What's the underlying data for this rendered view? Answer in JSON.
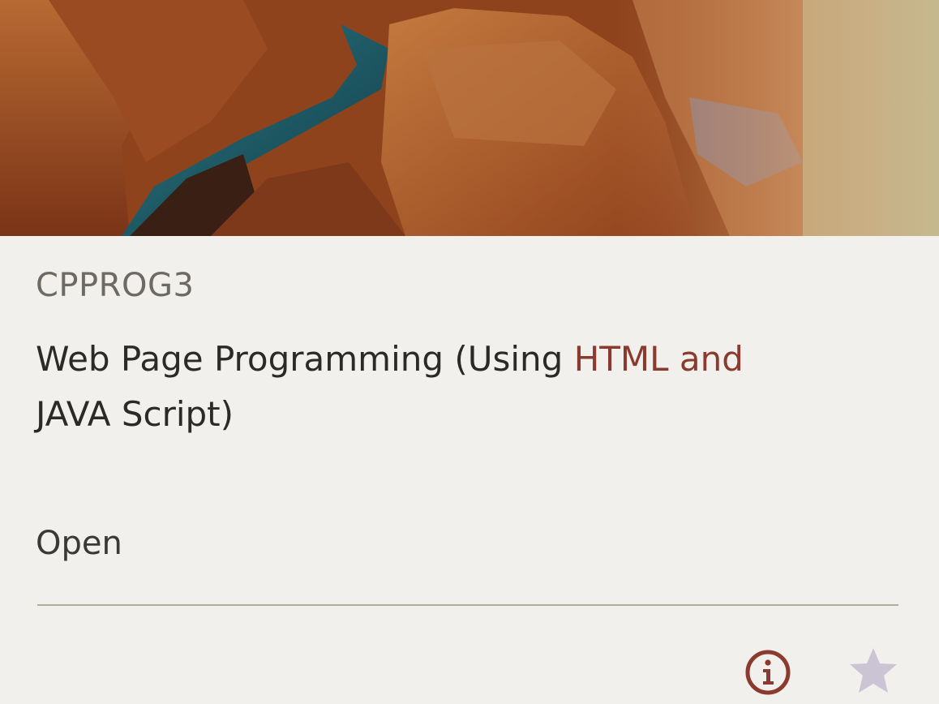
{
  "course": {
    "code": "CPPROG3",
    "title_part1": "Web Page Programming (Using ",
    "title_highlight": "HTML and",
    "title_part2": "JAVA Script)",
    "status": "Open"
  },
  "actions": {
    "info_icon": "info-icon",
    "favorite_icon": "star-icon"
  },
  "colors": {
    "accent": "#8a3a2e",
    "text_primary": "#2c2a27",
    "text_secondary": "#6d6a63",
    "divider": "#a8b39c"
  }
}
